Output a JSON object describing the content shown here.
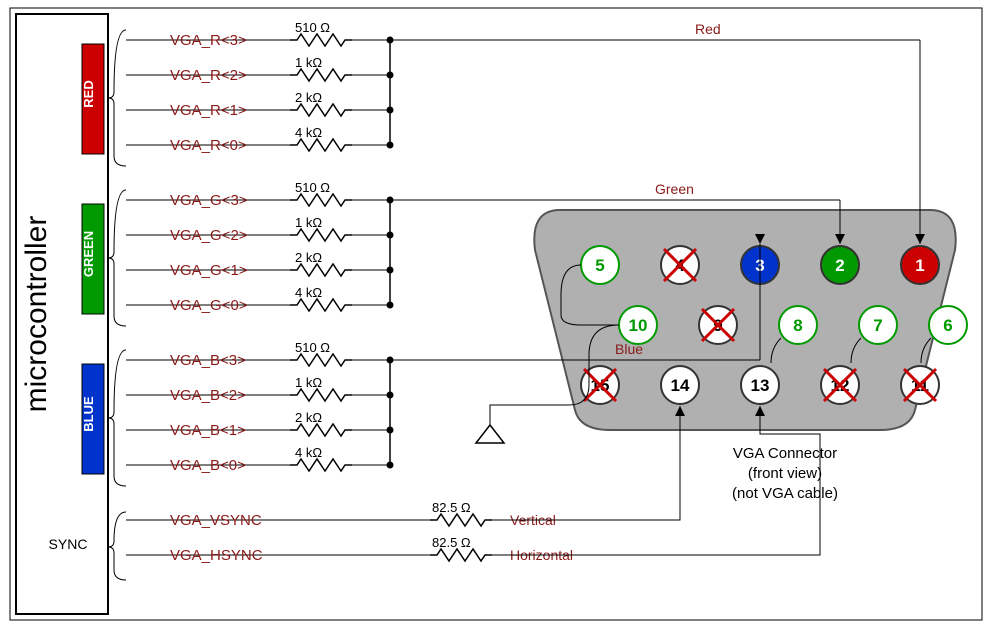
{
  "mcu_label": "microcontroller",
  "groups": [
    {
      "name": "RED",
      "color": "#cc0000",
      "signals": [
        {
          "label": "VGA_R<3>",
          "r": "510 Ω"
        },
        {
          "label": "VGA_R<2>",
          "r": "1 kΩ"
        },
        {
          "label": "VGA_R<1>",
          "r": "2 kΩ"
        },
        {
          "label": "VGA_R<0>",
          "r": "4 kΩ"
        }
      ],
      "out_label": "Red"
    },
    {
      "name": "GREEN",
      "color": "#009900",
      "signals": [
        {
          "label": "VGA_G<3>",
          "r": "510 Ω"
        },
        {
          "label": "VGA_G<2>",
          "r": "1 kΩ"
        },
        {
          "label": "VGA_G<1>",
          "r": "2 kΩ"
        },
        {
          "label": "VGA_G<0>",
          "r": "4 kΩ"
        }
      ],
      "out_label": "Green"
    },
    {
      "name": "BLUE",
      "color": "#0033cc",
      "signals": [
        {
          "label": "VGA_B<3>",
          "r": "510 Ω"
        },
        {
          "label": "VGA_B<2>",
          "r": "1 kΩ"
        },
        {
          "label": "VGA_B<1>",
          "r": "2 kΩ"
        },
        {
          "label": "VGA_B<0>",
          "r": "4 kΩ"
        }
      ],
      "out_label": "Blue"
    }
  ],
  "sync": {
    "name": "SYNC",
    "signals": [
      {
        "label": "VGA_VSYNC",
        "r": "82.5 Ω",
        "out": "Vertical"
      },
      {
        "label": "VGA_HSYNC",
        "r": "82.5 Ω",
        "out": "Horizontal"
      }
    ]
  },
  "connector": {
    "title": "VGA Connector",
    "sub1": "(front view)",
    "sub2": "(not VGA cable)",
    "pins": [
      {
        "n": "1",
        "fill": "#cc0000",
        "text": "#fff",
        "x": 0
      },
      {
        "n": "2",
        "fill": "#009900",
        "text": "#fff",
        "x": 0
      },
      {
        "n": "3",
        "fill": "#0033cc",
        "text": "#fff",
        "x": 0
      },
      {
        "n": "4",
        "fill": "#fff",
        "text": "#000",
        "x": 1
      },
      {
        "n": "5",
        "fill": "#fff",
        "text": "#009900",
        "x": 0
      },
      {
        "n": "6",
        "fill": "#fff",
        "text": "#009900",
        "x": 0
      },
      {
        "n": "7",
        "fill": "#fff",
        "text": "#009900",
        "x": 0
      },
      {
        "n": "8",
        "fill": "#fff",
        "text": "#009900",
        "x": 0
      },
      {
        "n": "9",
        "fill": "#fff",
        "text": "#000",
        "x": 1
      },
      {
        "n": "10",
        "fill": "#fff",
        "text": "#009900",
        "x": 0
      },
      {
        "n": "11",
        "fill": "#fff",
        "text": "#000",
        "x": 1
      },
      {
        "n": "12",
        "fill": "#fff",
        "text": "#000",
        "x": 1
      },
      {
        "n": "13",
        "fill": "#fff",
        "text": "#000",
        "x": 0
      },
      {
        "n": "14",
        "fill": "#fff",
        "text": "#000",
        "x": 0
      },
      {
        "n": "15",
        "fill": "#fff",
        "text": "#000",
        "x": 1
      }
    ]
  }
}
